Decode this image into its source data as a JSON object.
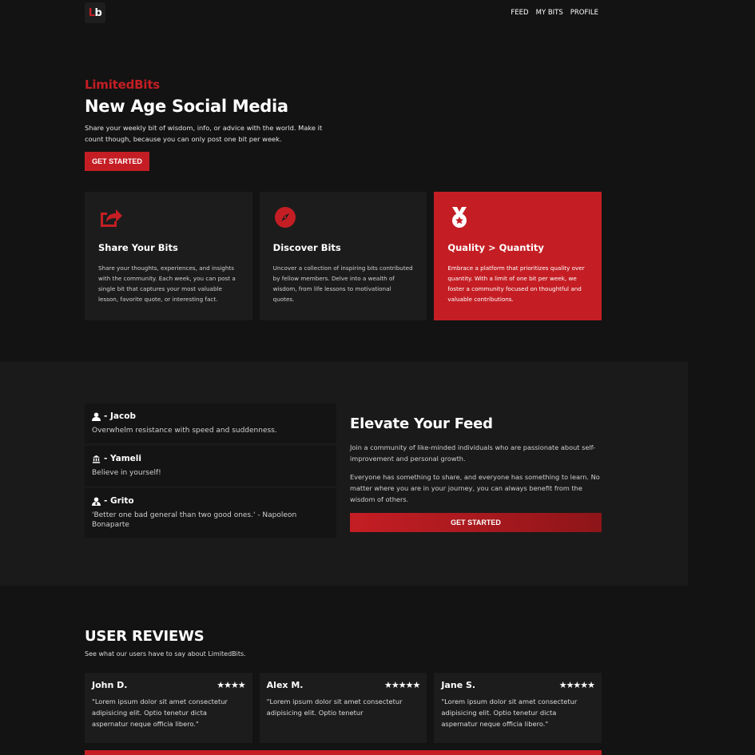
{
  "nav": {
    "logo_l": "L",
    "logo_b": "b",
    "links": [
      "FEED",
      "MY BITS",
      "PROFILE"
    ]
  },
  "hero": {
    "brand": "LimitedBits",
    "title": "New Age Social Media",
    "description": "Share your weekly bit of wisdom, info, or advice with the world. Make it count though, because you can only post one bit per week.",
    "cta": "GET STARTED"
  },
  "features": [
    {
      "icon": "share-icon",
      "title": "Share Your Bits",
      "text": "Share your thoughts, experiences, and insights with the community. Each week, you can post a single bit that captures your most valuable lesson, favorite quote, or interesting fact."
    },
    {
      "icon": "compass-icon",
      "title": "Discover Bits",
      "text": "Uncover a collection of inspiring bits contributed by fellow members. Delve into a wealth of wisdom, from life lessons to motivational quotes."
    },
    {
      "icon": "medal-icon",
      "title": "Quality > Quantity",
      "text": "Embrace a platform that prioritizes quality over quantity. With a limit of one bit per week, we foster a community focused on thoughtful and valuable contributions."
    }
  ],
  "quotes": [
    {
      "icon": "user-icon",
      "author": "- Jacob",
      "text": "Overwhelm resistance with speed and suddenness."
    },
    {
      "icon": "user-bank-icon",
      "author": "- Yameli",
      "text": "Believe in yourself!"
    },
    {
      "icon": "user-tie-icon",
      "author": "- Grito",
      "text": "'Better one bad general than two good ones.' - Napoleon Bonaparte"
    }
  ],
  "elevate": {
    "title": "Elevate Your Feed",
    "p1": "Join a community of like-minded individuals who are passionate about self-improvement and personal growth.",
    "p2": "Everyone has something to share, and everyone has something to learn. No matter where you are in your journey, you can always benefit from the wisdom of others.",
    "cta": "GET STARTED"
  },
  "reviews": {
    "title": "USER REVIEWS",
    "subtitle": "See what our users have to say about LimitedBits.",
    "items": [
      {
        "name": "John D.",
        "stars": "★★★★",
        "text": "\"Lorem ipsum dolor sit amet consectetur adipisicing elit. Optio tenetur dicta aspernatur neque officia libero.\""
      },
      {
        "name": "Alex M.",
        "stars": "★★★★★",
        "text": "\"Lorem ipsum dolor sit amet consectetur adipisicing elit. Optio tenetur"
      },
      {
        "name": "Jane S.",
        "stars": "★★★★★",
        "text": "\"Lorem ipsum dolor sit amet consectetur adipisicing elit. Optio tenetur dicta aspernatur neque officia libero.\""
      }
    ]
  },
  "colors": {
    "accent": "#c41e24",
    "background": "#131313",
    "card": "#1c1c1c"
  }
}
